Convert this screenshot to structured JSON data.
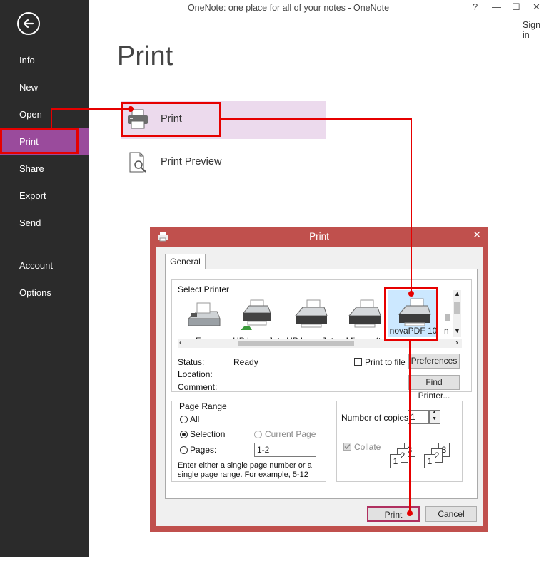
{
  "window": {
    "title": "OneNote: one place for all of your notes - OneNote",
    "help": "?",
    "minimize": "—",
    "maximize": "☐",
    "close": "✕",
    "sign_in": "Sign in"
  },
  "sidebar": {
    "items": [
      {
        "label": "Info"
      },
      {
        "label": "New"
      },
      {
        "label": "Open"
      },
      {
        "label": "Print"
      },
      {
        "label": "Share"
      },
      {
        "label": "Export"
      },
      {
        "label": "Send"
      },
      {
        "label": "Account"
      },
      {
        "label": "Options"
      }
    ],
    "active": "Print"
  },
  "main": {
    "title": "Print",
    "options": [
      {
        "label": "Print",
        "icon": "printer-icon"
      },
      {
        "label": "Print Preview",
        "icon": "print-preview-icon"
      }
    ]
  },
  "dialog": {
    "title": "Print",
    "close": "✕",
    "tab": "General",
    "select_printer": {
      "label": "Select Printer",
      "printers": [
        "Fax",
        "HP LaserJet",
        "HP LaserJet",
        "Microsoft",
        "novaPDF 10",
        "n"
      ],
      "selected": "novaPDF 10"
    },
    "status": {
      "status_label": "Status:",
      "status_value": "Ready",
      "location_label": "Location:",
      "comment_label": "Comment:"
    },
    "print_to_file": "Print to file",
    "preferences_button": "Preferences",
    "find_printer_button": "Find Printer...",
    "page_range": {
      "label": "Page Range",
      "all": "All",
      "selection": "Selection",
      "current_page": "Current Page",
      "pages": "Pages:",
      "pages_value": "1-2",
      "hint": "Enter either a single page number or a single page range.  For example, 5-12",
      "selected": "Selection"
    },
    "copies": {
      "label": "Number of copies:",
      "value": "1",
      "collate": "Collate",
      "collate_checked": true,
      "pages_icon": [
        "1",
        "2",
        "3"
      ]
    },
    "print_button": "Print",
    "cancel_button": "Cancel"
  },
  "colors": {
    "sidebar_bg": "#2b2b2b",
    "sidebar_active": "#9a4b9c",
    "option_selected": "#ecdaed",
    "dialog_frame": "#c0504d",
    "annotation": "#e60000"
  }
}
